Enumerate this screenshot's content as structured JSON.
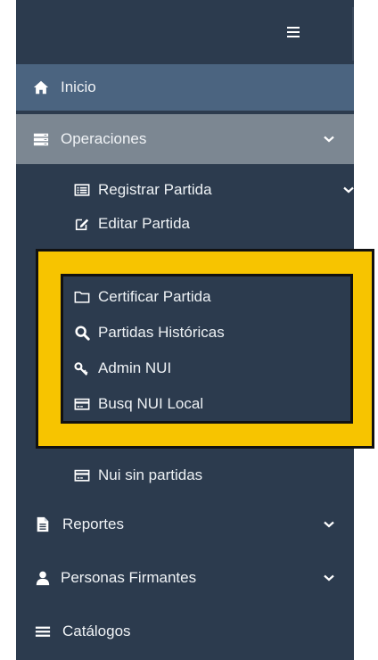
{
  "sidebar": {
    "menu_icon": "hamburger-icon",
    "items": [
      {
        "label": "Inicio",
        "icon": "home-icon"
      },
      {
        "label": "Operaciones",
        "icon": "server-icon"
      },
      {
        "label": "Reportes",
        "icon": "file-icon"
      },
      {
        "label": "Personas Firmantes",
        "icon": "user-icon"
      },
      {
        "label": "Catálogos",
        "icon": "list-icon"
      }
    ],
    "submenu": [
      {
        "label": "Registrar Partida",
        "icon": "list-alt-icon"
      },
      {
        "label": "Editar Partida",
        "icon": "edit-icon"
      },
      {
        "label": "Certificar Partida",
        "icon": "folder-open-icon"
      },
      {
        "label": "Partidas Históricas",
        "icon": "search-icon"
      },
      {
        "label": "Admin NUI",
        "icon": "key-icon"
      },
      {
        "label": "Busq NUI Local",
        "icon": "credit-card-icon"
      },
      {
        "label": "Nui sin partidas",
        "icon": "credit-card-icon"
      }
    ]
  },
  "colors": {
    "sidebar_bg": "#2c3b4e",
    "active_item_bg": "#4b6480",
    "open_item_bg": "#7c8792",
    "highlight_frame": "#f7c400"
  }
}
